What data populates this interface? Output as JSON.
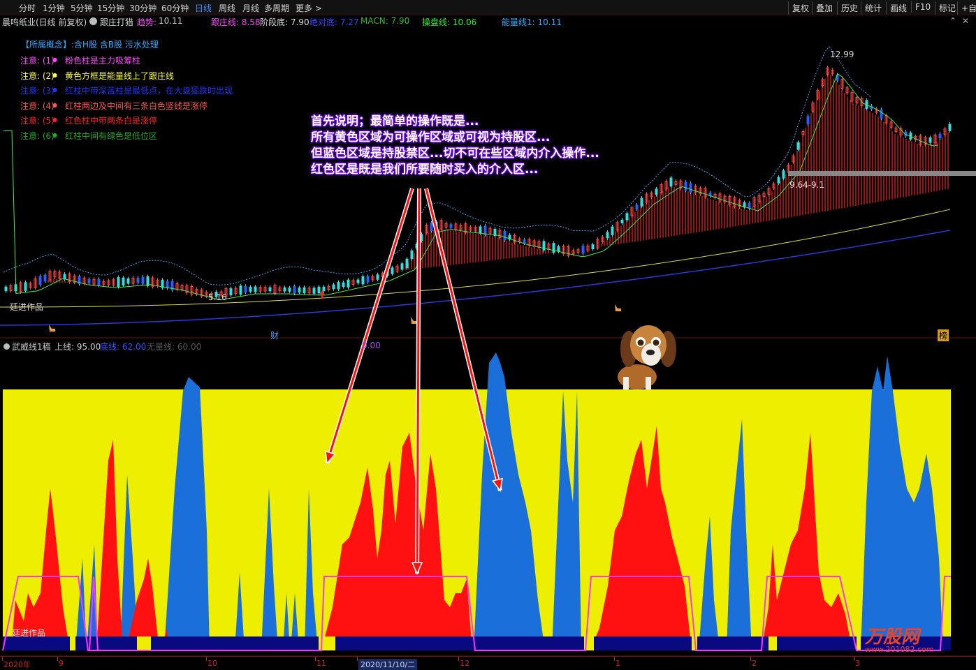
{
  "toolbar": {
    "periods": [
      "分时",
      "1分钟",
      "5分钟",
      "15分钟",
      "30分钟",
      "60分钟",
      "日线",
      "周线",
      "月线",
      "多周期",
      "更多 >"
    ],
    "active_period": "日线",
    "right_buttons": [
      "复权",
      "叠加",
      "历史",
      "统计",
      "画线",
      "F10",
      "标记",
      "+自选"
    ]
  },
  "header": {
    "stock": "晨鸣纸业(日线 前复权)",
    "indicator": "跟庄打猎",
    "trend_label": "趋势:",
    "trend_value": "10.11",
    "follow_label": "跟庄线: 8.58",
    "stage_label": "阶段底: 7.90",
    "absolute_bottom": "绝对底: 7.27",
    "macn": "MACN: 7.90",
    "operator_line": "操盘线: 10.06",
    "energy_line": "能量线1: 10.11"
  },
  "concepts": {
    "label": "【所属概念】:",
    "value": "含H股 含B股 污水处理"
  },
  "notes": [
    {
      "tag": "注意: (1)",
      "text": "粉色柱是主力吸筹柱",
      "tag_color": "#ff44ff",
      "text_color": "#ff44ff"
    },
    {
      "tag": "注意: (2)",
      "text": "黄色方框是能量线上了跟庄线",
      "tag_color": "#ffff44",
      "text_color": "#ffff44"
    },
    {
      "tag": "注意: (3)",
      "text": "红柱中带深蓝柱是最低点，在大盘猛跌时出现",
      "tag_color": "#2233ff",
      "text_color": "#2233ff"
    },
    {
      "tag": "注意: (4)",
      "text": "红柱两边及中间有三条白色竖线是涨停",
      "tag_color": "#ff5555",
      "text_color": "#ff5555"
    },
    {
      "tag": "注意: (5)",
      "text": "红色柱中带两条白是涨停",
      "tag_color": "#ff2222",
      "text_color": "#ff2222"
    },
    {
      "tag": "注意: (6)",
      "text": "红柱中间有绿色是低位区",
      "tag_color": "#22aa22",
      "text_color": "#22aa22"
    }
  ],
  "annotation": [
    "首先说明；最简单的操作既是...",
    "所有黄色区域为可操作区域或可视为持股区...",
    "但蓝色区域是持股禁区...切不可在些区域内介入操作...",
    "红色区是既是我们所要随时买入的介入区..."
  ],
  "markers": {
    "high_price": "12.99",
    "low_price": "5.16",
    "price_tag": "9.64-9.1",
    "author_mark": "廷进作品",
    "cai_tag": "财",
    "bang_tag": "榜"
  },
  "sub_header": {
    "name": "武威线1稿",
    "upper": "上线: 95.00",
    "bottom": "底线: 62.00",
    "slope": "无量线: 60.00",
    "extra": "0.00"
  },
  "dates": {
    "labels": [
      "2020年",
      "9",
      "10",
      "11",
      "2020/11/10/二",
      "12",
      "1",
      "2",
      "3"
    ]
  },
  "watermark": {
    "site": "万股网",
    "url": "www.201082.com"
  },
  "colors": {
    "bg": "#000000",
    "up": "#ff3333",
    "down": "#00cccc",
    "osc_yellow": "#eeee00",
    "osc_red": "#ff1111",
    "osc_blue": "#1a6fd8",
    "osc_navy": "#0a0a80",
    "magenta": "#ff33ff",
    "ma_yellow": "#dddd33",
    "ma_blue": "#2a3ad8"
  },
  "chart_data": {
    "type": "candlestick+area",
    "price_range": [
      5.16,
      12.99
    ],
    "key_points": [
      {
        "label": "low",
        "value": 5.16
      },
      {
        "label": "high",
        "value": 12.99
      }
    ],
    "oscillator": {
      "upper": 95.0,
      "bottom": 62.0,
      "zero_line": 60.0,
      "zones": [
        "yellow: operable / hold",
        "blue: no-hold zone",
        "red: buy zone"
      ]
    }
  }
}
